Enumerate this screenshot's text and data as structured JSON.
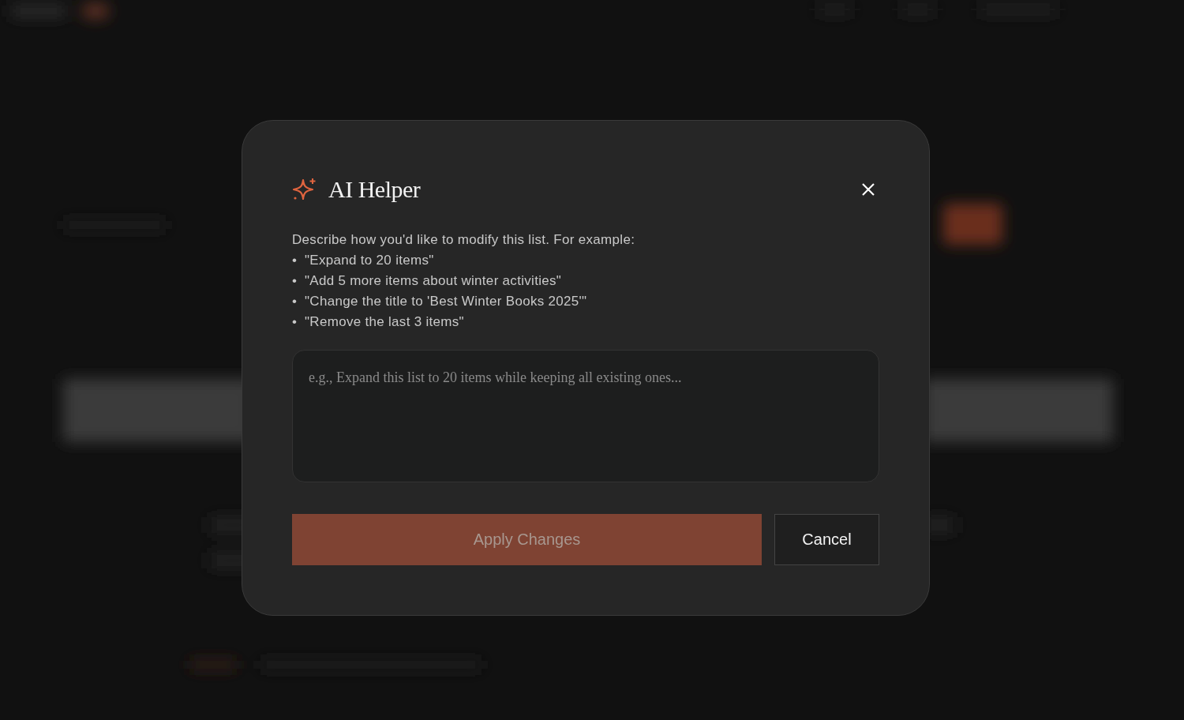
{
  "dialog": {
    "title": "AI Helper",
    "intro": "Describe how you'd like to modify this list. For example:",
    "examples": [
      "\"Expand to 20 items\"",
      "\"Add 5 more items about winter activities\"",
      "\"Change the title to 'Best Winter Books 2025'\"",
      "\"Remove the last 3 items\""
    ],
    "bullet": "•",
    "input": {
      "placeholder": "e.g., Expand this list to 20 items while keeping all existing ones..."
    },
    "buttons": [
      {
        "kind": "primary",
        "label": "Apply Changes",
        "disabled": true
      },
      {
        "kind": "secondary",
        "label": "Cancel",
        "disabled": false
      }
    ]
  }
}
